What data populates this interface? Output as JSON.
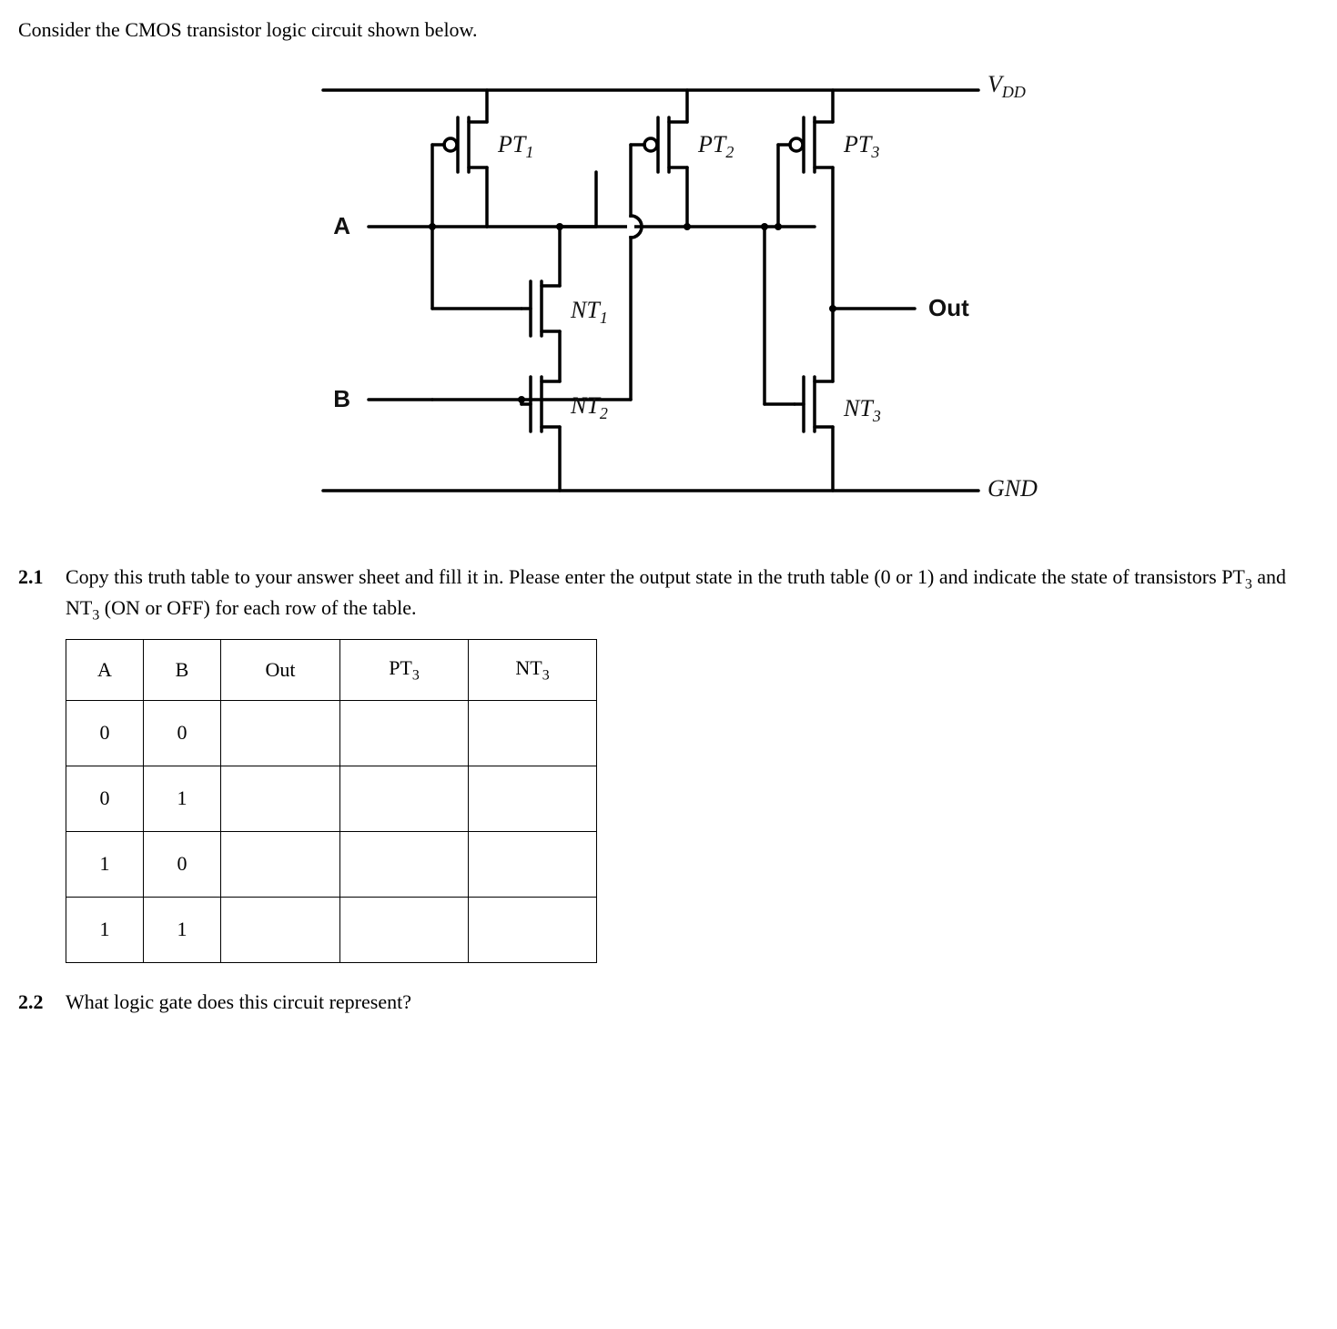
{
  "intro": "Consider the CMOS transistor logic circuit shown below.",
  "labels": {
    "vdd": "V",
    "vdd_sub": "DD",
    "gnd": "GND",
    "A": "A",
    "B": "B",
    "Out": "Out",
    "PT1": "PT",
    "PT1_sub": "1",
    "PT2": "PT",
    "PT2_sub": "2",
    "PT3": "PT",
    "PT3_sub": "3",
    "NT1": "NT",
    "NT1_sub": "1",
    "NT2": "NT",
    "NT2_sub": "2",
    "NT3": "NT",
    "NT3_sub": "3"
  },
  "q21": {
    "num": "2.1",
    "text_a": "Copy this truth table to your answer sheet and fill it in. Please enter the output state in the truth table (0 or 1) and indicate the state of transistors PT",
    "text_b": " and NT",
    "text_c": " (ON or OFF) for each row of the table.",
    "sub3": "3"
  },
  "table": {
    "headers": {
      "A": "A",
      "B": "B",
      "Out": "Out",
      "PT3": "PT",
      "PT3_sub": "3",
      "NT3": "NT",
      "NT3_sub": "3"
    },
    "rows": [
      {
        "A": "0",
        "B": "0",
        "Out": "",
        "PT3": "",
        "NT3": ""
      },
      {
        "A": "0",
        "B": "1",
        "Out": "",
        "PT3": "",
        "NT3": ""
      },
      {
        "A": "1",
        "B": "0",
        "Out": "",
        "PT3": "",
        "NT3": ""
      },
      {
        "A": "1",
        "B": "1",
        "Out": "",
        "PT3": "",
        "NT3": ""
      }
    ]
  },
  "q22": {
    "num": "2.2",
    "text": "What logic gate does this circuit represent?"
  }
}
